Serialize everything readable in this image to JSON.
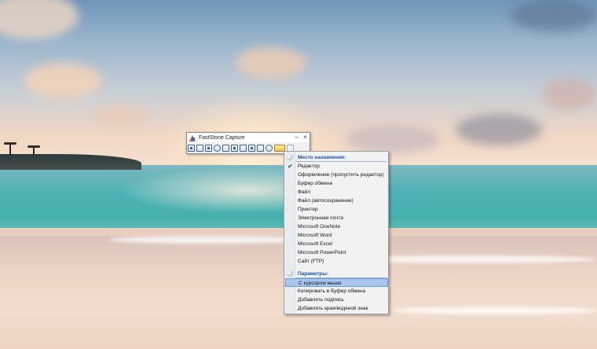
{
  "window": {
    "title": "FastStone Capture",
    "minimize_glyph": "–",
    "close_glyph": "×"
  },
  "toolbar": {
    "tools": [
      {
        "icon": "capture-active-window-icon"
      },
      {
        "icon": "capture-window-object-icon"
      },
      {
        "icon": "capture-rectangular-region-icon"
      },
      {
        "icon": "capture-freehand-region-icon"
      },
      {
        "icon": "capture-full-screen-icon"
      },
      {
        "icon": "capture-scrolling-window-icon"
      },
      {
        "icon": "capture-fixed-region-icon"
      },
      {
        "icon": "screen-recorder-icon"
      },
      {
        "icon": "video-recorder-icon"
      },
      {
        "icon": "delay-timer-icon"
      },
      {
        "icon": "output-destination-icon"
      },
      {
        "icon": "settings-icon"
      }
    ]
  },
  "menu": {
    "destination_header": "Место назначения:",
    "destinations": [
      {
        "label": "Редактор",
        "checked": true
      },
      {
        "label": "Оформление (пропустить редактор)",
        "checked": false
      },
      {
        "label": "Буфер обмена",
        "checked": false
      },
      {
        "label": "Файл",
        "checked": false
      },
      {
        "label": "Файл (автосохранение)",
        "checked": false
      },
      {
        "label": "Принтер",
        "checked": false
      },
      {
        "label": "Электронная почта",
        "checked": false
      },
      {
        "label": "Microsoft OneNote",
        "checked": false
      },
      {
        "label": "Microsoft Word",
        "checked": false
      },
      {
        "label": "Microsoft Excel",
        "checked": false
      },
      {
        "label": "Microsoft PowerPoint",
        "checked": false
      },
      {
        "label": "Сайт (FTP)",
        "checked": false
      }
    ],
    "options_header": "Параметры:",
    "options": [
      {
        "label": "С курсором мыши",
        "highlighted": true
      },
      {
        "label": "Копировать в Буфер обмена",
        "highlighted": false
      },
      {
        "label": "Добавлять подпись",
        "highlighted": false
      },
      {
        "label": "Добавлять края/водяной знак",
        "highlighted": false
      }
    ],
    "check_glyph": "✔"
  }
}
